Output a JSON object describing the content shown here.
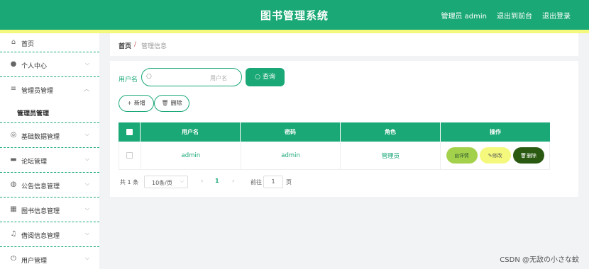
{
  "header": {
    "title": "图书管理系统",
    "user_label": "管理员 admin",
    "front_link": "退出到前台",
    "logout_link": "退出登录"
  },
  "sidebar": {
    "items": [
      {
        "label": "首页",
        "icon": "home-icon"
      },
      {
        "label": "个人中心",
        "icon": "user-icon"
      },
      {
        "label": "管理员管理",
        "icon": "list-icon",
        "sub": "管理员管理"
      },
      {
        "label": "基础数据管理",
        "icon": "compass-icon"
      },
      {
        "label": "论坛管理",
        "icon": "monitor-icon"
      },
      {
        "label": "公告信息管理",
        "icon": "globe-icon"
      },
      {
        "label": "图书信息管理",
        "icon": "grid-icon"
      },
      {
        "label": "借阅信息管理",
        "icon": "bell-icon"
      },
      {
        "label": "用户管理",
        "icon": "power-icon"
      }
    ]
  },
  "breadcrumb": {
    "home": "首页",
    "separator": "/",
    "current": "管理信息"
  },
  "search": {
    "label": "用户名",
    "placeholder": "用户名",
    "button": "查询"
  },
  "actions": {
    "add": "新增",
    "delete": "删除"
  },
  "table": {
    "headers": [
      "用户名",
      "密码",
      "角色",
      "操作"
    ],
    "rows": [
      {
        "username": "admin",
        "password": "admin",
        "role": "管理员"
      }
    ],
    "row_actions": {
      "detail": "详情",
      "edit": "修改",
      "delete": "删除"
    }
  },
  "pagination": {
    "total": "共 1 条",
    "page_size": "10条/页",
    "current_page": "1",
    "goto_label": "前往",
    "goto_value": "1",
    "page_suffix": "页"
  },
  "watermark": "CSDN @无敌の小さな蚊",
  "colors": {
    "primary": "#1aa876",
    "accent_yellow": "#f4f97d",
    "detail": "#a4d14b",
    "delete": "#2a5a12"
  }
}
